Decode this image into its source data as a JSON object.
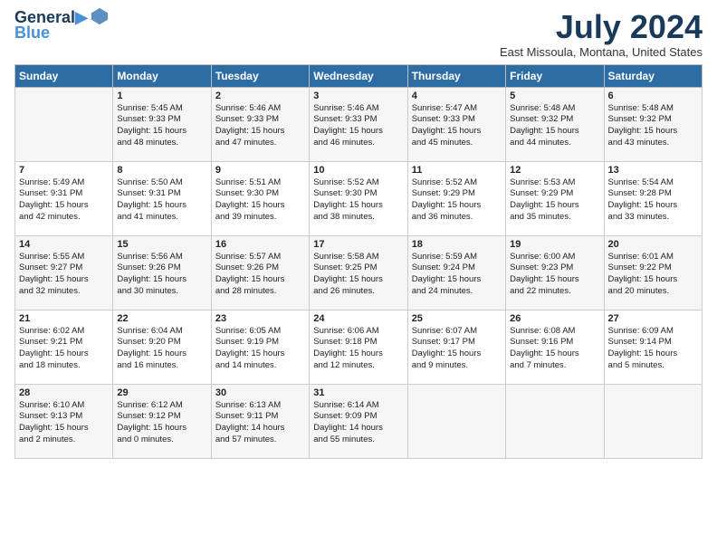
{
  "header": {
    "logo_line1": "General",
    "logo_line2": "Blue",
    "month_title": "July 2024",
    "location": "East Missoula, Montana, United States"
  },
  "days_of_week": [
    "Sunday",
    "Monday",
    "Tuesday",
    "Wednesday",
    "Thursday",
    "Friday",
    "Saturday"
  ],
  "weeks": [
    [
      {
        "day": "",
        "info": ""
      },
      {
        "day": "1",
        "info": "Sunrise: 5:45 AM\nSunset: 9:33 PM\nDaylight: 15 hours\nand 48 minutes."
      },
      {
        "day": "2",
        "info": "Sunrise: 5:46 AM\nSunset: 9:33 PM\nDaylight: 15 hours\nand 47 minutes."
      },
      {
        "day": "3",
        "info": "Sunrise: 5:46 AM\nSunset: 9:33 PM\nDaylight: 15 hours\nand 46 minutes."
      },
      {
        "day": "4",
        "info": "Sunrise: 5:47 AM\nSunset: 9:33 PM\nDaylight: 15 hours\nand 45 minutes."
      },
      {
        "day": "5",
        "info": "Sunrise: 5:48 AM\nSunset: 9:32 PM\nDaylight: 15 hours\nand 44 minutes."
      },
      {
        "day": "6",
        "info": "Sunrise: 5:48 AM\nSunset: 9:32 PM\nDaylight: 15 hours\nand 43 minutes."
      }
    ],
    [
      {
        "day": "7",
        "info": "Sunrise: 5:49 AM\nSunset: 9:31 PM\nDaylight: 15 hours\nand 42 minutes."
      },
      {
        "day": "8",
        "info": "Sunrise: 5:50 AM\nSunset: 9:31 PM\nDaylight: 15 hours\nand 41 minutes."
      },
      {
        "day": "9",
        "info": "Sunrise: 5:51 AM\nSunset: 9:30 PM\nDaylight: 15 hours\nand 39 minutes."
      },
      {
        "day": "10",
        "info": "Sunrise: 5:52 AM\nSunset: 9:30 PM\nDaylight: 15 hours\nand 38 minutes."
      },
      {
        "day": "11",
        "info": "Sunrise: 5:52 AM\nSunset: 9:29 PM\nDaylight: 15 hours\nand 36 minutes."
      },
      {
        "day": "12",
        "info": "Sunrise: 5:53 AM\nSunset: 9:29 PM\nDaylight: 15 hours\nand 35 minutes."
      },
      {
        "day": "13",
        "info": "Sunrise: 5:54 AM\nSunset: 9:28 PM\nDaylight: 15 hours\nand 33 minutes."
      }
    ],
    [
      {
        "day": "14",
        "info": "Sunrise: 5:55 AM\nSunset: 9:27 PM\nDaylight: 15 hours\nand 32 minutes."
      },
      {
        "day": "15",
        "info": "Sunrise: 5:56 AM\nSunset: 9:26 PM\nDaylight: 15 hours\nand 30 minutes."
      },
      {
        "day": "16",
        "info": "Sunrise: 5:57 AM\nSunset: 9:26 PM\nDaylight: 15 hours\nand 28 minutes."
      },
      {
        "day": "17",
        "info": "Sunrise: 5:58 AM\nSunset: 9:25 PM\nDaylight: 15 hours\nand 26 minutes."
      },
      {
        "day": "18",
        "info": "Sunrise: 5:59 AM\nSunset: 9:24 PM\nDaylight: 15 hours\nand 24 minutes."
      },
      {
        "day": "19",
        "info": "Sunrise: 6:00 AM\nSunset: 9:23 PM\nDaylight: 15 hours\nand 22 minutes."
      },
      {
        "day": "20",
        "info": "Sunrise: 6:01 AM\nSunset: 9:22 PM\nDaylight: 15 hours\nand 20 minutes."
      }
    ],
    [
      {
        "day": "21",
        "info": "Sunrise: 6:02 AM\nSunset: 9:21 PM\nDaylight: 15 hours\nand 18 minutes."
      },
      {
        "day": "22",
        "info": "Sunrise: 6:04 AM\nSunset: 9:20 PM\nDaylight: 15 hours\nand 16 minutes."
      },
      {
        "day": "23",
        "info": "Sunrise: 6:05 AM\nSunset: 9:19 PM\nDaylight: 15 hours\nand 14 minutes."
      },
      {
        "day": "24",
        "info": "Sunrise: 6:06 AM\nSunset: 9:18 PM\nDaylight: 15 hours\nand 12 minutes."
      },
      {
        "day": "25",
        "info": "Sunrise: 6:07 AM\nSunset: 9:17 PM\nDaylight: 15 hours\nand 9 minutes."
      },
      {
        "day": "26",
        "info": "Sunrise: 6:08 AM\nSunset: 9:16 PM\nDaylight: 15 hours\nand 7 minutes."
      },
      {
        "day": "27",
        "info": "Sunrise: 6:09 AM\nSunset: 9:14 PM\nDaylight: 15 hours\nand 5 minutes."
      }
    ],
    [
      {
        "day": "28",
        "info": "Sunrise: 6:10 AM\nSunset: 9:13 PM\nDaylight: 15 hours\nand 2 minutes."
      },
      {
        "day": "29",
        "info": "Sunrise: 6:12 AM\nSunset: 9:12 PM\nDaylight: 15 hours\nand 0 minutes."
      },
      {
        "day": "30",
        "info": "Sunrise: 6:13 AM\nSunset: 9:11 PM\nDaylight: 14 hours\nand 57 minutes."
      },
      {
        "day": "31",
        "info": "Sunrise: 6:14 AM\nSunset: 9:09 PM\nDaylight: 14 hours\nand 55 minutes."
      },
      {
        "day": "",
        "info": ""
      },
      {
        "day": "",
        "info": ""
      },
      {
        "day": "",
        "info": ""
      }
    ]
  ]
}
